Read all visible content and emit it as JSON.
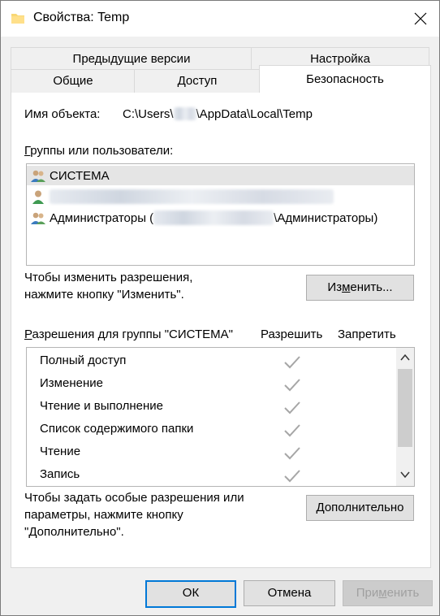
{
  "window": {
    "title": "Свойства: Temp"
  },
  "tabs": {
    "previous_versions": "Предыдущие версии",
    "customize": "Настройка",
    "general": "Общие",
    "sharing": "Доступ",
    "security": "Безопасность"
  },
  "object": {
    "label": "Имя объекта:",
    "path_start": "C:\\Users\\",
    "path_end": "\\AppData\\Local\\Temp"
  },
  "groups": {
    "label_accel": "Г",
    "label_rest": "руппы или пользователи:",
    "items": [
      {
        "name": "СИСТЕМА",
        "icon": "group-icon"
      },
      {
        "name": "",
        "icon": "user-icon"
      },
      {
        "name_start": "Администраторы (",
        "name_end": "\\Администраторы)",
        "icon": "group-icon"
      }
    ]
  },
  "change_hint": {
    "line1": "Чтобы изменить разрешения,",
    "line2": "нажмите кнопку \"Изменить\"."
  },
  "edit_button": {
    "pre": "Из",
    "accel": "м",
    "post": "енить..."
  },
  "permissions": {
    "header_accel": "Р",
    "header_rest": "азрешения для группы \"СИСТЕМА\"",
    "allow": "Разрешить",
    "deny": "Запретить",
    "items": [
      {
        "name": "Полный доступ",
        "allow": true,
        "deny": false
      },
      {
        "name": "Изменение",
        "allow": true,
        "deny": false
      },
      {
        "name": "Чтение и выполнение",
        "allow": true,
        "deny": false
      },
      {
        "name": "Список содержимого папки",
        "allow": true,
        "deny": false
      },
      {
        "name": "Чтение",
        "allow": true,
        "deny": false
      },
      {
        "name": "Запись",
        "allow": true,
        "deny": false
      }
    ]
  },
  "advanced_hint": {
    "line1": "Чтобы задать особые разрешения или",
    "line2": "параметры, нажмите кнопку",
    "line3": "\"Дополнительно\"."
  },
  "advanced_button": {
    "accel": "Д",
    "rest": "ополнительно"
  },
  "footer": {
    "ok": "ОК",
    "cancel": "Отмена",
    "apply_pre": "При",
    "apply_accel": "м",
    "apply_post": "енить"
  },
  "colors": {
    "accent": "#0078d7",
    "check": "#a6a6a6",
    "selection": "#e5e5e5"
  }
}
